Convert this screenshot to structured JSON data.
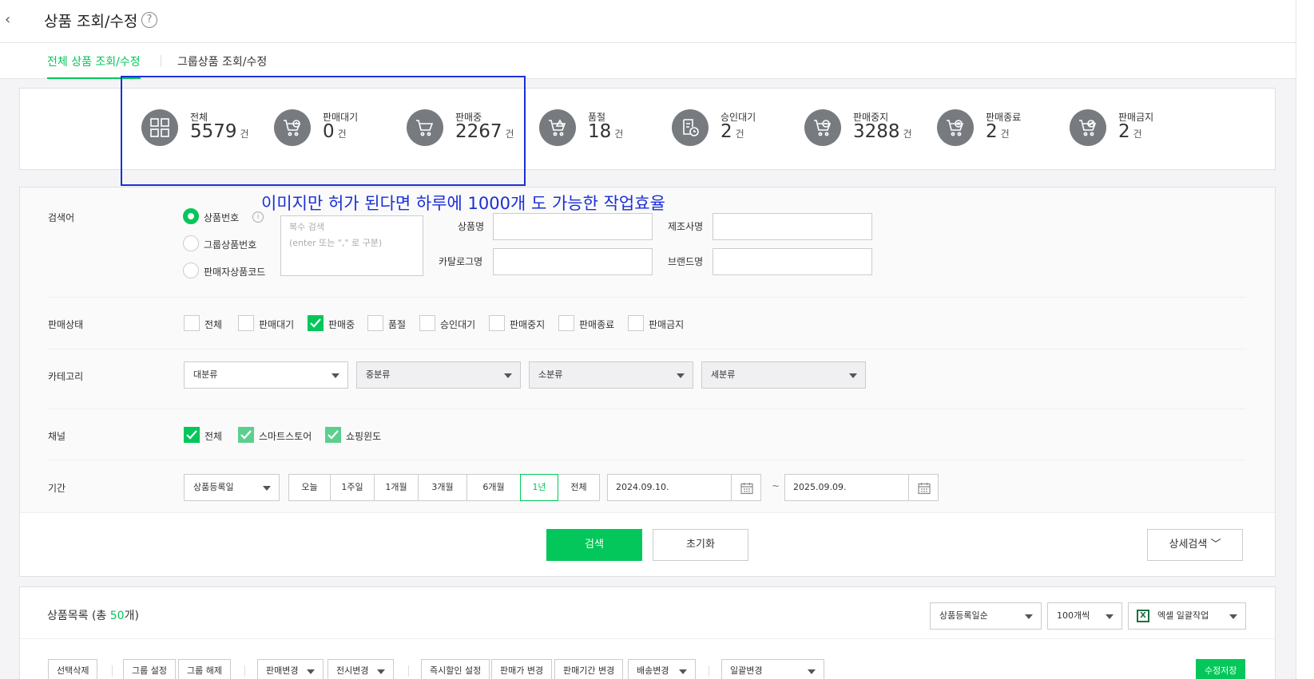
{
  "header": {
    "back_glyph": "‹",
    "title": "상품 조회/수정",
    "help_glyph": "?"
  },
  "tabs": [
    {
      "label": "전체 상품 조회/수정",
      "active": true
    },
    {
      "label": "그룹상품 조회/수정",
      "active": false
    }
  ],
  "stats": [
    {
      "label": "전체",
      "value": "5579",
      "unit": "건",
      "icon": "grid-icon"
    },
    {
      "label": "판매대기",
      "value": "0",
      "unit": "건",
      "icon": "cart-clock-icon"
    },
    {
      "label": "판매중",
      "value": "2267",
      "unit": "건",
      "icon": "cart-icon"
    },
    {
      "label": "품절",
      "value": "18",
      "unit": "건",
      "icon": "cart-warning-icon"
    },
    {
      "label": "승인대기",
      "value": "2",
      "unit": "건",
      "icon": "document-clock-icon"
    },
    {
      "label": "판매중지",
      "value": "3288",
      "unit": "건",
      "icon": "cart-minus-icon"
    },
    {
      "label": "판매종료",
      "value": "2",
      "unit": "건",
      "icon": "cart-x-icon"
    },
    {
      "label": "판매금지",
      "value": "2",
      "unit": "건",
      "icon": "cart-prohibited-icon"
    }
  ],
  "annotation": "이미지만  허가 된다면  하루에  1000개 도 가능한 작업효율",
  "search": {
    "label": "검색어",
    "radios": [
      {
        "label": "상품번호",
        "checked": true
      },
      {
        "label": "그룹상품번호",
        "checked": false
      },
      {
        "label": "판매자상품코드",
        "checked": false
      }
    ],
    "info_glyph": "i",
    "textarea_placeholder": "복수 검색\n(enter 또는 \",\" 로 구분)",
    "product_name_label": "상품명",
    "manufacturer_label": "제조사명",
    "catalog_label": "카탈로그명",
    "brand_label": "브랜드명"
  },
  "status": {
    "label": "판매상태",
    "options": [
      {
        "label": "전체",
        "checked": false
      },
      {
        "label": "판매대기",
        "checked": false
      },
      {
        "label": "판매중",
        "checked": true
      },
      {
        "label": "품절",
        "checked": false
      },
      {
        "label": "승인대기",
        "checked": false
      },
      {
        "label": "판매중지",
        "checked": false
      },
      {
        "label": "판매종료",
        "checked": false
      },
      {
        "label": "판매금지",
        "checked": false
      }
    ]
  },
  "category": {
    "label": "카테고리",
    "selects": [
      "대분류",
      "중분류",
      "소분류",
      "세분류"
    ]
  },
  "channel": {
    "label": "채널",
    "options": [
      {
        "label": "전체",
        "checked": true
      },
      {
        "label": "스마트스토어",
        "checked": true
      },
      {
        "label": "쇼핑윈도",
        "checked": true
      }
    ]
  },
  "period": {
    "label": "기간",
    "type_select": "상품등록일",
    "buttons": [
      "오늘",
      "1주일",
      "1개월",
      "3개월",
      "6개월",
      "1년",
      "전체"
    ],
    "active": "1년",
    "start_date": "2024.09.10.",
    "end_date": "2025.09.09.",
    "tilde": "~"
  },
  "actions": {
    "search": "검색",
    "reset": "초기화",
    "detail": "상세검색 ﹀"
  },
  "list": {
    "title_prefix": "상품목록 (총 ",
    "count": "50",
    "title_suffix": "개)",
    "sort_select": "상품등록일순",
    "page_size_select": "100개씩",
    "excel_select": "엑셀 일괄작업",
    "excel_glyph": "X",
    "toolbar": {
      "delete": "선택삭제",
      "group_set": "그룹 설정",
      "group_unset": "그룹 해제",
      "sale_change": "판매변경",
      "display_change": "전시변경",
      "instant_discount": "즉시할인 설정",
      "price_change": "판매가 변경",
      "period_change": "판매기간 변경",
      "delivery_change": "배송변경",
      "bulk_change": "일괄변경",
      "save": "수정저장"
    }
  },
  "colors": {
    "accent": "#03c75a",
    "annotation": "#1b2fd6",
    "icon_bg": "#777b80"
  }
}
